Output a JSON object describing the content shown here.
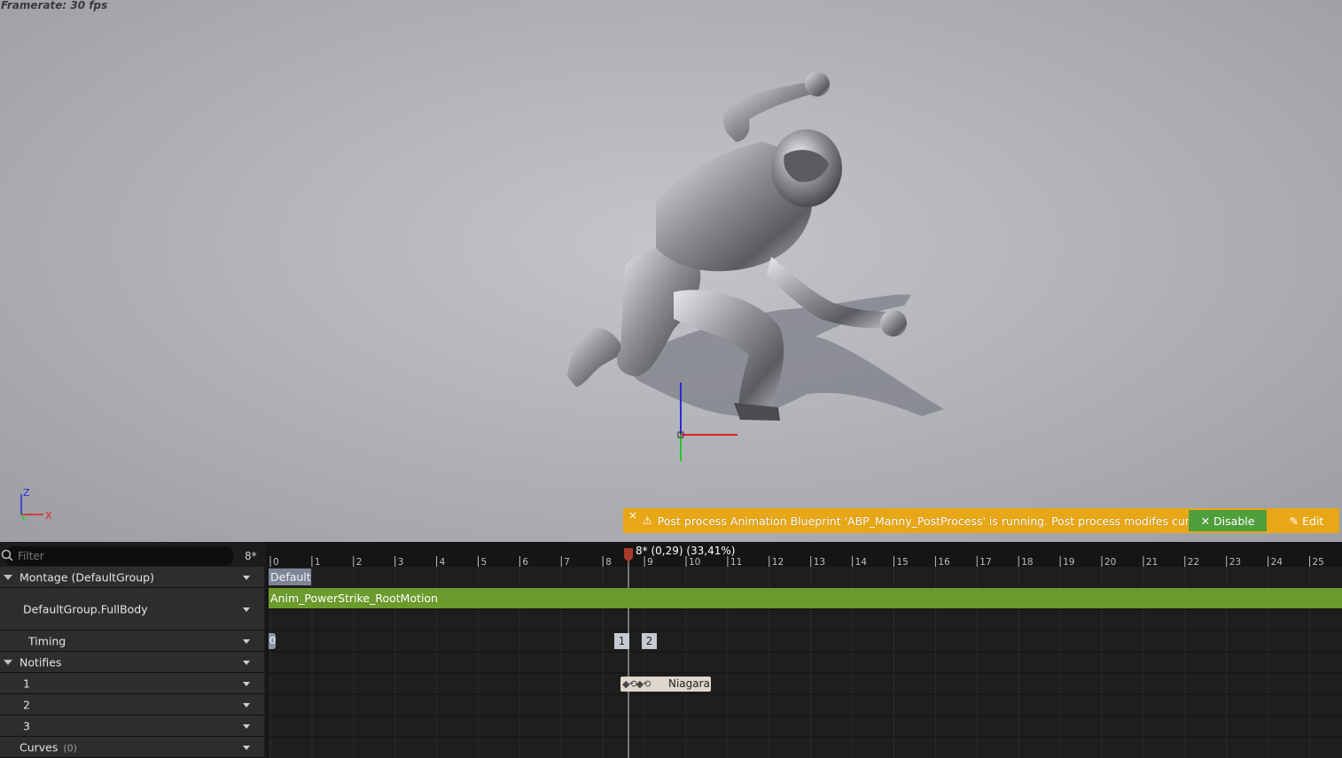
{
  "viewport": {
    "framerate_label": "Framerate: 30 fps",
    "axis_labels": {
      "z": "Z",
      "x": "X"
    }
  },
  "warning": {
    "close_glyph": "×",
    "icon": "warning-icon",
    "message": "Post process Animation Blueprint 'ABP_Manny_PostProcess' is running. Post process modifes curves.",
    "disable_label": "Disable",
    "edit_label": "Edit",
    "color": "#e8a716"
  },
  "filter": {
    "placeholder": "Filter",
    "frame_indicator": "8*"
  },
  "tracks": {
    "montage": "Montage (DefaultGroup)",
    "slot": "DefaultGroup.FullBody",
    "timing": "Timing",
    "notifies": "Notifies",
    "notify_tracks": [
      "1",
      "2",
      "3"
    ],
    "curves": "Curves",
    "curves_count": "(0)"
  },
  "timeline": {
    "scrub_label": "8* (0,29) (33,41%)",
    "tick_labels": [
      "0",
      "1",
      "2",
      "3",
      "4",
      "5",
      "6",
      "7",
      "8",
      "9",
      "10",
      "11",
      "12",
      "13",
      "14",
      "15",
      "16",
      "17",
      "18",
      "19",
      "20",
      "21",
      "22",
      "23",
      "24",
      "25"
    ],
    "default_slot_label": "Default",
    "montage_segment_label": "Anim_PowerStrike_RootMotion",
    "section_marker_0": "0",
    "section_markers": [
      "1",
      "2"
    ],
    "notify_label": "Niagara",
    "notify_glyphs": "◆⟲◆⟲",
    "montage_color": "#6b9a2d",
    "scrub_color": "#c0392b"
  }
}
